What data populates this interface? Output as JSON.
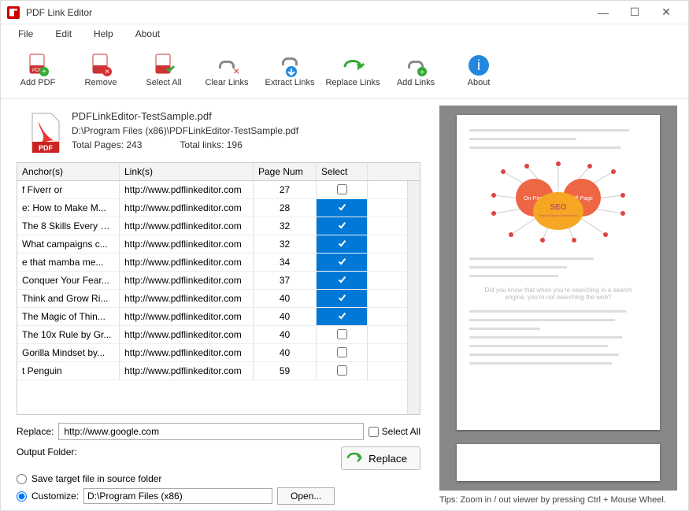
{
  "window": {
    "title": "PDF Link Editor"
  },
  "menu": {
    "file": "File",
    "edit": "Edit",
    "help": "Help",
    "about": "About"
  },
  "toolbar": {
    "addpdf": "Add PDF",
    "remove": "Remove",
    "selectall": "Select All",
    "clearlinks": "Clear Links",
    "extractlinks": "Extract Links",
    "replacelinks": "Replace Links",
    "addlinks": "Add Links",
    "about": "About"
  },
  "file": {
    "name": "PDFLinkEditor-TestSample.pdf",
    "path": "D:\\Program Files (x86)\\PDFLinkEditor-TestSample.pdf",
    "pages_label": "Total Pages: 243",
    "links_label": "Total links: 196"
  },
  "table": {
    "headers": {
      "anchor": "Anchor(s)",
      "link": "Link(s)",
      "pagenum": "Page Num",
      "select": "Select"
    },
    "rows": [
      {
        "anchor": "f Fiverr or",
        "link": "http://www.pdflinkeditor.com",
        "page": "27",
        "selected": false
      },
      {
        "anchor": "e: How to Make M...",
        "link": "http://www.pdflinkeditor.com",
        "page": "28",
        "selected": true
      },
      {
        "anchor": "The 8 Skills Every S...",
        "link": "http://www.pdflinkeditor.com",
        "page": "32",
        "selected": true
      },
      {
        "anchor": "What campaigns c...",
        "link": "http://www.pdflinkeditor.com",
        "page": "32",
        "selected": true
      },
      {
        "anchor": "e that mamba me...",
        "link": "http://www.pdflinkeditor.com",
        "page": "34",
        "selected": true
      },
      {
        "anchor": "Conquer Your Fear...",
        "link": "http://www.pdflinkeditor.com",
        "page": "37",
        "selected": true
      },
      {
        "anchor": "Think and Grow Ri...",
        "link": "http://www.pdflinkeditor.com",
        "page": "40",
        "selected": true
      },
      {
        "anchor": "The Magic of Thin...",
        "link": "http://www.pdflinkeditor.com",
        "page": "40",
        "selected": true
      },
      {
        "anchor": "The 10x Rule by Gr...",
        "link": "http://www.pdflinkeditor.com",
        "page": "40",
        "selected": false
      },
      {
        "anchor": "Gorilla Mindset by...",
        "link": "http://www.pdflinkeditor.com",
        "page": "40",
        "selected": false
      },
      {
        "anchor": "t Penguin",
        "link": "http://www.pdflinkeditor.com",
        "page": "59",
        "selected": false
      }
    ]
  },
  "replace": {
    "label": "Replace:",
    "value": "http://www.google.com",
    "selectall_label": "Select All",
    "selectall_checked": false
  },
  "output": {
    "folder_label": "Output Folder:",
    "save_source_label": "Save target file in source folder",
    "customize_label": "Customize:",
    "customize_value": "D:\\Program Files (x86)",
    "open_label": "Open...",
    "replace_button": "Replace",
    "mode": "customize"
  },
  "preview": {
    "tips": "Tips: Zoom in / out viewer by pressing Ctrl + Mouse Wheel.",
    "headline": "Did you know that when you're searching in a search engine, you're not searching the web?",
    "seo_center": "SEO",
    "seo_center_sub": "Search Engine Optimization",
    "onpage": "On-Page",
    "offpage": "Off-Page"
  }
}
